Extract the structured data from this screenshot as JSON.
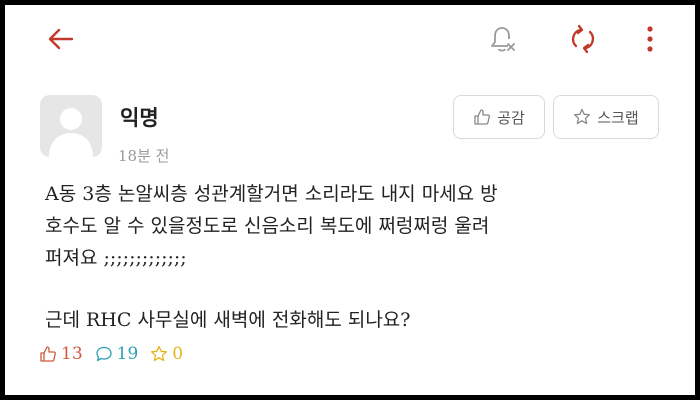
{
  "post": {
    "author": "익명",
    "time": "18분 전",
    "body": [
      "A동 3층 논알씨층 성관계할거면 소리라도 내지 마세요 방",
      "호수도 알 수 있을정도로 신음소리 복도에 쩌렁쩌렁 울려",
      "퍼져요 ;;;;;;;;;;;;;",
      "",
      "근데 RHC 사무실에 새벽에 전화해도 되나요?"
    ]
  },
  "actions": {
    "like_label": "공감",
    "scrap_label": "스크랩"
  },
  "stats": {
    "likes": "13",
    "comments": "19",
    "scraps": "0"
  },
  "colors": {
    "accent": "#c0392b",
    "like": "#d05a3c",
    "comment": "#2f9fb3",
    "scrap": "#e6b31e"
  },
  "icons": [
    "back-arrow-icon",
    "notification-off-icon",
    "refresh-icon",
    "more-vertical-icon",
    "thumbs-up-icon",
    "star-icon",
    "comment-icon"
  ]
}
